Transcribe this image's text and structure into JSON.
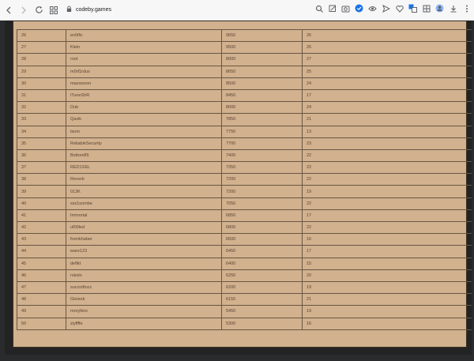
{
  "browser": {
    "url": "codeby.games",
    "icons": [
      "back-icon",
      "forward-icon",
      "reload-icon",
      "tabs-icon",
      "lock-icon",
      "search-icon",
      "edit-icon",
      "camera-icon",
      "shield-icon",
      "eye-icon",
      "send-icon",
      "heart-icon",
      "translate-icon",
      "extensions-icon",
      "profile-icon",
      "download-icon",
      "menu-icon"
    ]
  },
  "table": {
    "rows": [
      [
        "26",
        "en0ific",
        "9650",
        "26"
      ],
      [
        "27",
        "Klein",
        "9500",
        "26"
      ],
      [
        "28",
        "root",
        "8900",
        "27"
      ],
      [
        "29",
        "m0rf1rdus",
        "8650",
        "25"
      ],
      [
        "30",
        "maxxwoon",
        "8500",
        "24"
      ],
      [
        "31",
        "iTuneShR",
        "8450",
        "17"
      ],
      [
        "32",
        "Dub",
        "8000",
        "24"
      ],
      [
        "33",
        "Qavik",
        "7850",
        "21"
      ],
      [
        "34",
        "tsom",
        "7750",
        "13"
      ],
      [
        "35",
        "ReliableSecurity",
        "7700",
        "23"
      ],
      [
        "36",
        "Bottom85",
        "7400",
        "22"
      ],
      [
        "37",
        "RED1XEL",
        "7350",
        "22"
      ],
      [
        "38",
        "Reverb",
        "7200",
        "22"
      ],
      [
        "39",
        "013K",
        "7200",
        "19"
      ],
      [
        "40",
        "sss1sombe",
        "7050",
        "22"
      ],
      [
        "41",
        "Immortal",
        "6850",
        "17"
      ],
      [
        "42",
        "uf00led",
        "6800",
        "22"
      ],
      [
        "43",
        "fromkhaber",
        "6500",
        "16"
      ],
      [
        "44",
        "ware123",
        "6450",
        "17"
      ],
      [
        "45",
        "deflkt",
        "6400",
        "15"
      ],
      [
        "46",
        "rskolo",
        "6250",
        "20"
      ],
      [
        "47",
        "succnitfucc",
        "6200",
        "19"
      ],
      [
        "48",
        "Gleisok",
        "6150",
        "21"
      ],
      [
        "49",
        "morylkov",
        "5450",
        "19"
      ],
      [
        "50",
        "ziyffffe",
        "5300",
        "16"
      ]
    ]
  }
}
